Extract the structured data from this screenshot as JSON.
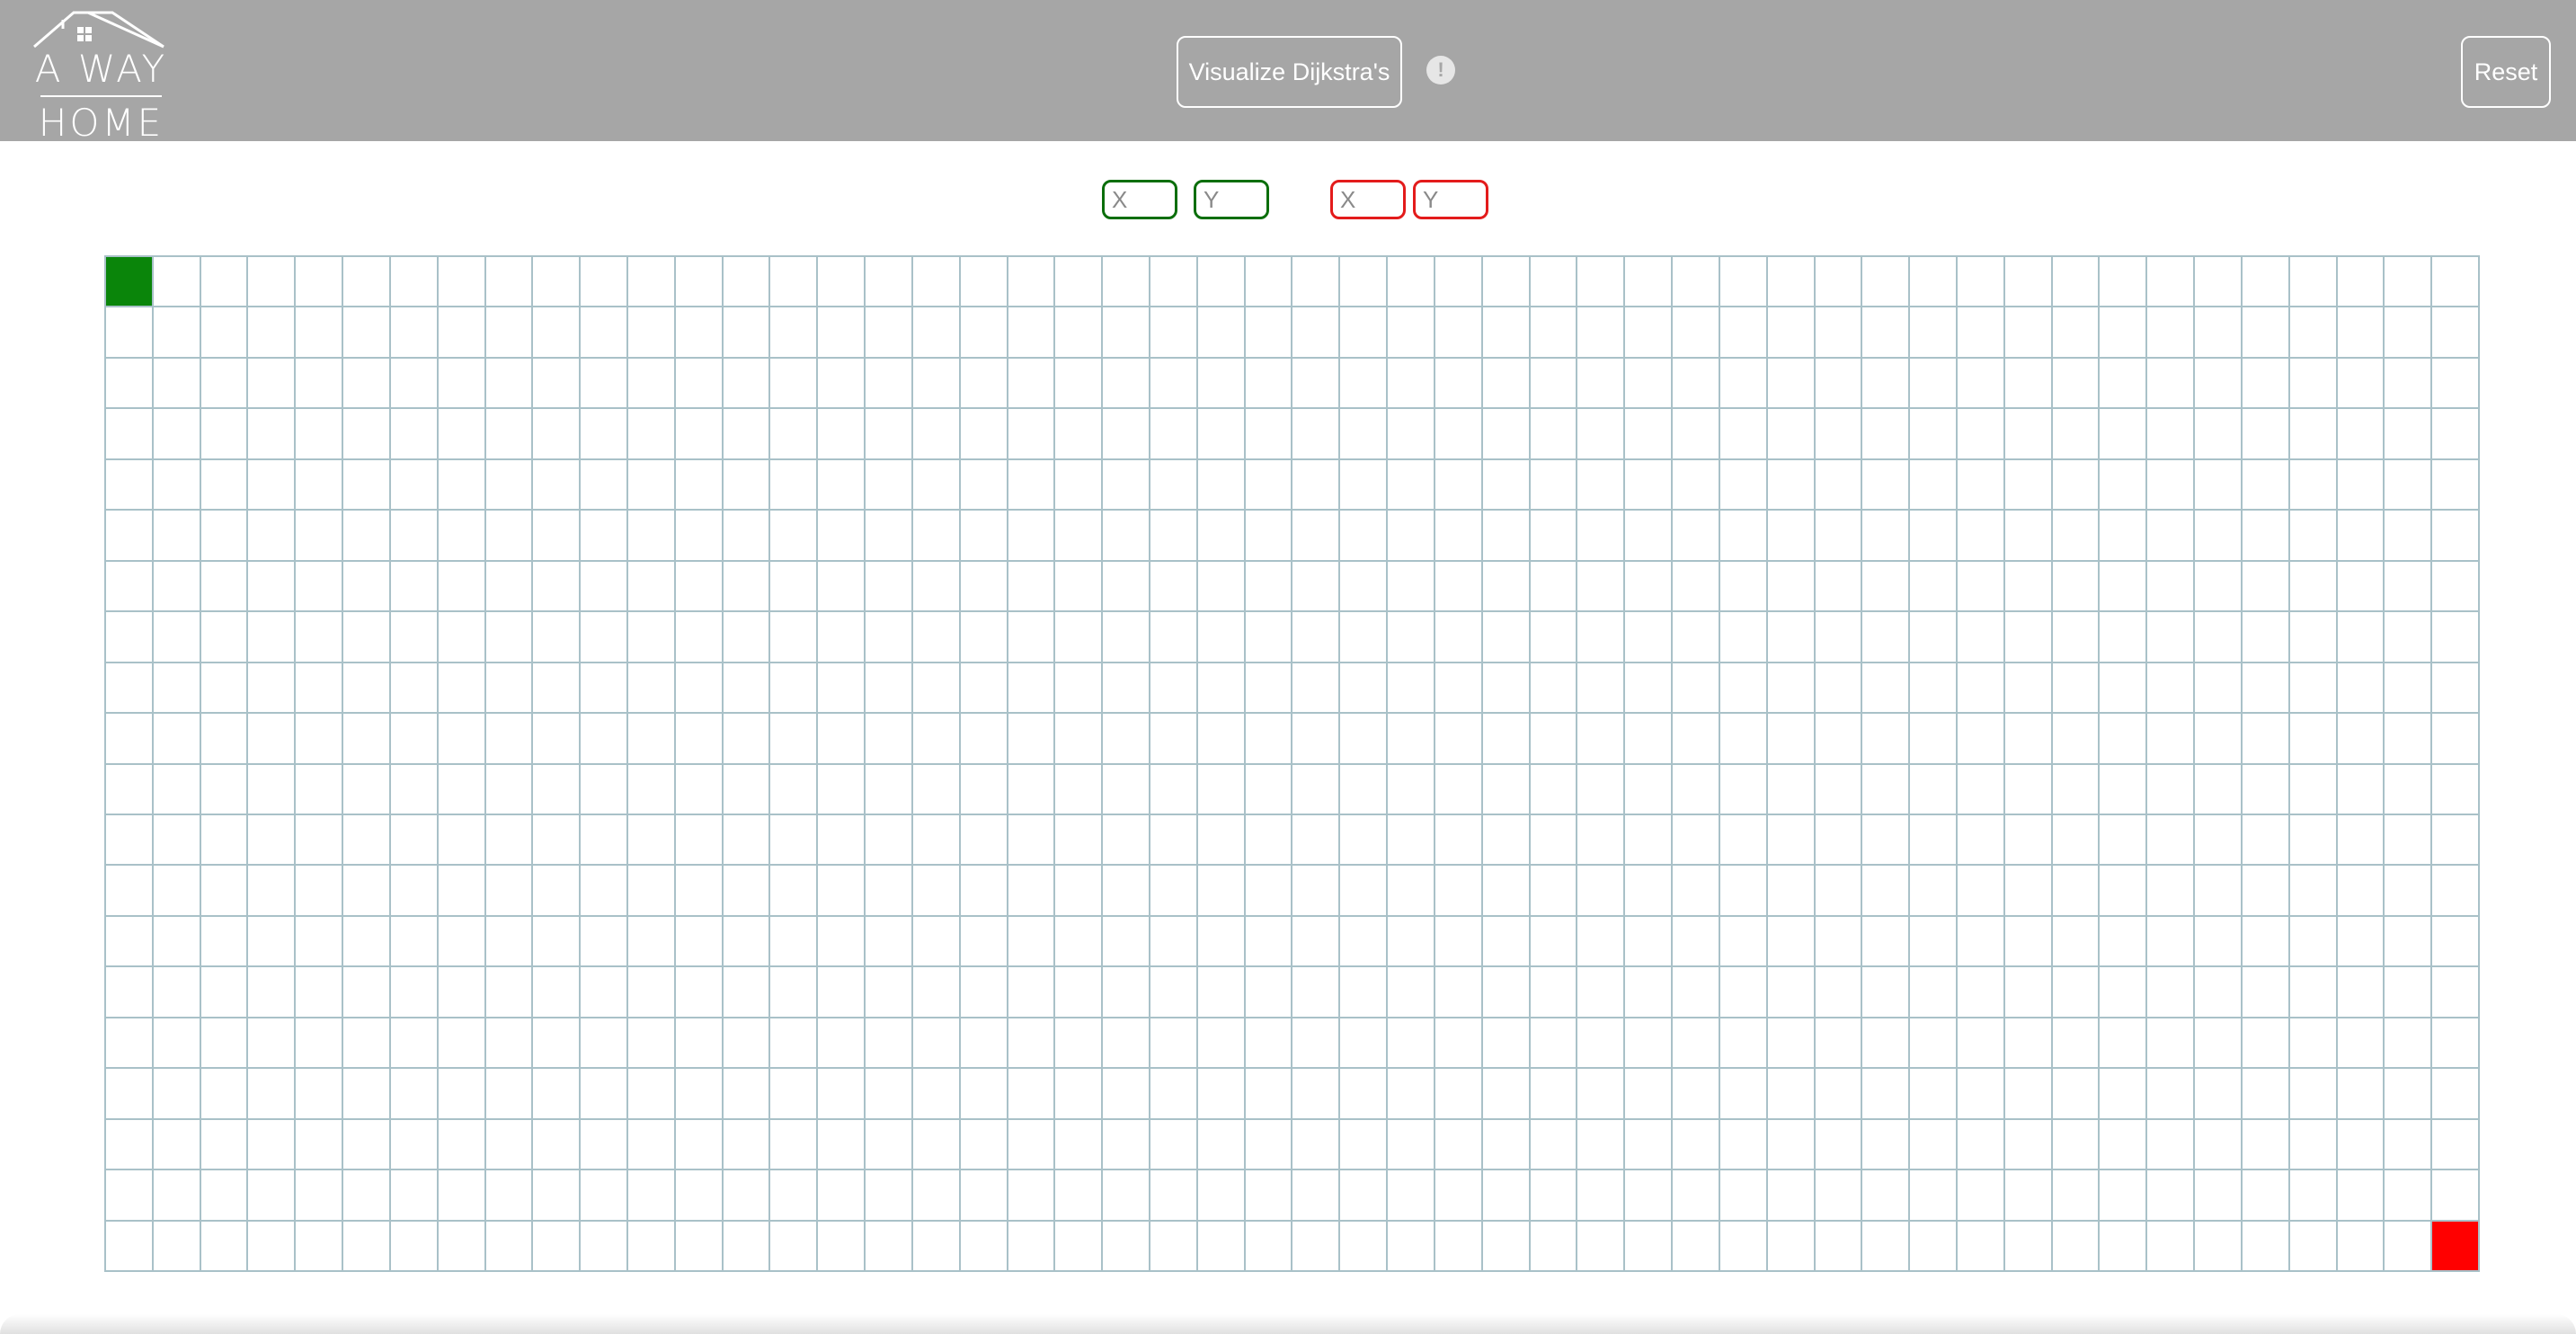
{
  "header": {
    "logo": {
      "line1": "A WAY",
      "line2": "HOME",
      "icon": "house-roof-icon"
    },
    "visualize_label": "Visualize Dijkstra's",
    "info_icon_glyph": "!",
    "reset_label": "Reset",
    "background_color": "#a6a6a6"
  },
  "coords": {
    "start": {
      "x_placeholder": "X",
      "y_placeholder": "Y",
      "color": "#0b6e0b"
    },
    "end": {
      "x_placeholder": "X",
      "y_placeholder": "Y",
      "color": "#e31b1b"
    }
  },
  "grid": {
    "columns": 50,
    "rows": 20,
    "start_node": {
      "row": 0,
      "col": 0,
      "color": "#0a850a"
    },
    "end_node": {
      "row": 19,
      "col": 49,
      "color": "#ff0000"
    },
    "line_color": "#a9c1c8"
  }
}
